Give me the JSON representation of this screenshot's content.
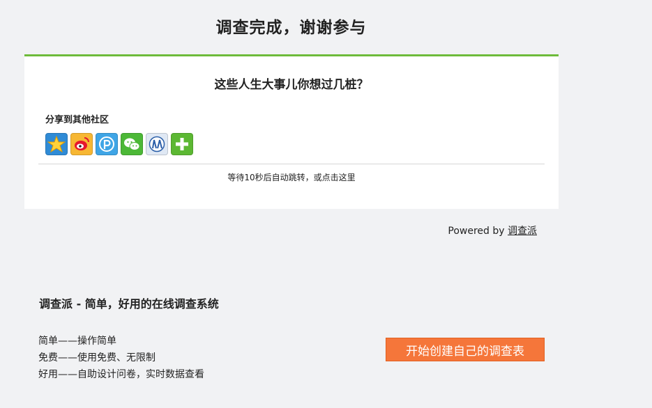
{
  "header": {
    "title": "调查完成，谢谢参与"
  },
  "card": {
    "survey_name": "这些人生大事儿你想过几桩？",
    "share_label": "分享到其他社区",
    "share_buttons": [
      {
        "icon": "qzone-star-icon",
        "color": "#2f8bd6"
      },
      {
        "icon": "weibo-icon",
        "color": "#f7b733"
      },
      {
        "icon": "pengyou-icon",
        "color": "#3fa5e6"
      },
      {
        "icon": "wechat-icon",
        "color": "#4cb837"
      },
      {
        "icon": "renren-icon",
        "color": "#dfe8f4"
      },
      {
        "icon": "plus-icon",
        "color": "#5cb833"
      }
    ],
    "redirect_text": "等待10秒后自动跳转，或点击这里"
  },
  "powered": {
    "prefix": "Powered by",
    "link": "调查派"
  },
  "promo": {
    "title": "调查派 - 简单，好用的在线调查系统",
    "features": [
      "简单——操作简单",
      "免费——使用免费、无限制",
      "好用——自助设计问卷，实时数据查看"
    ],
    "cta_label": "开始创建自己的调查表"
  },
  "colors": {
    "accent_green": "#6dbb3a",
    "cta_orange": "#f5763a",
    "page_bg": "#f1f2f4"
  }
}
